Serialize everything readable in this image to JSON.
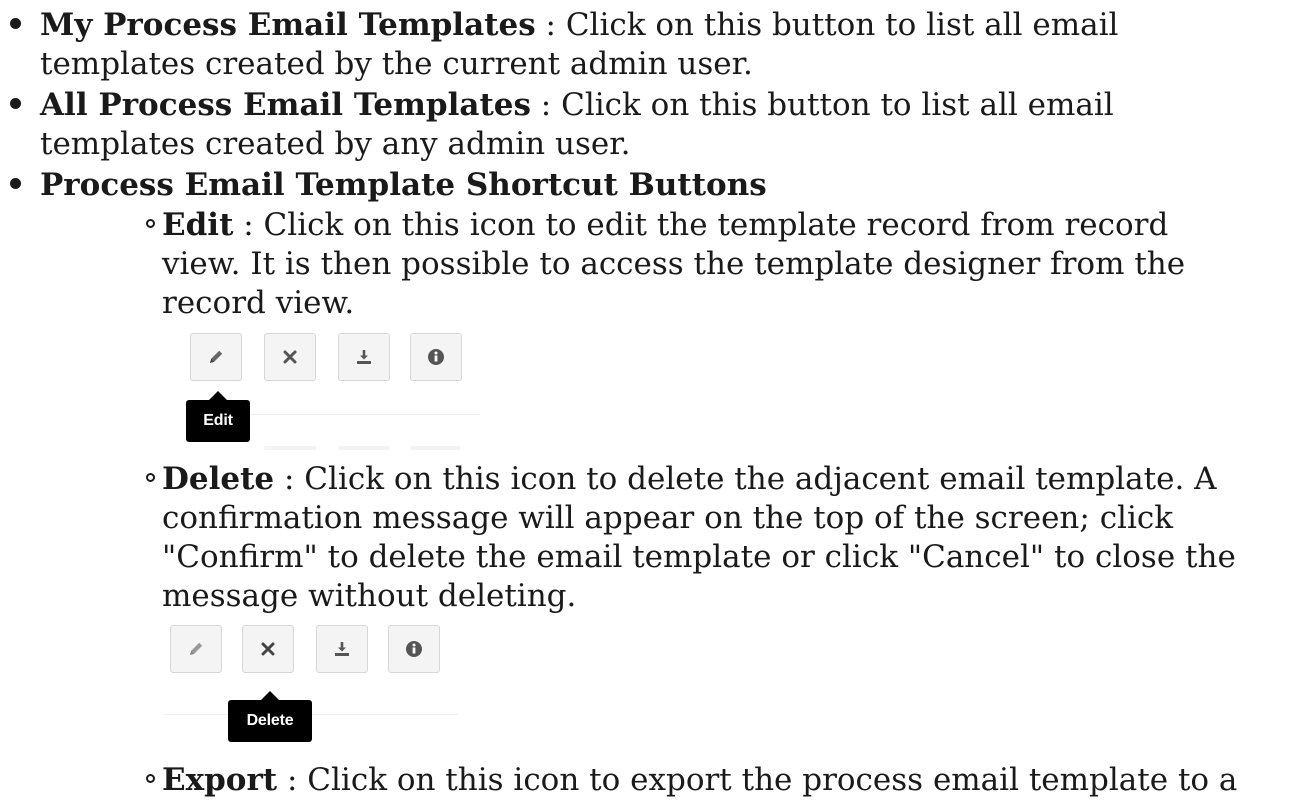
{
  "items": [
    {
      "title": "My Process Email Templates",
      "line1": " : Click on this button to list all email",
      "line2": "templates created by the current admin user."
    },
    {
      "title": "All Process Email Templates",
      "line1": " : Click on this button to list all email",
      "line2": "templates created by any admin user."
    },
    {
      "title": "Process Email Template Shortcut Buttons"
    }
  ],
  "sub_items": [
    {
      "title": "Edit",
      "line1": " : Click on this icon to edit the template record from record",
      "line2": "view. It is then possible to access the template designer from the",
      "line3": "record view.",
      "tooltip": "Edit"
    },
    {
      "title": "Delete",
      "line1": " : Click on this icon to delete the adjacent email template. A",
      "line2": "confirmation message will appear on the top of the screen; click",
      "line3": "\"Confirm\" to delete the email template or click \"Cancel\" to close the",
      "line4": "message without deleting.",
      "tooltip": "Delete"
    },
    {
      "title": "Export",
      "line1": " : Click on this icon to export the process email template to a"
    }
  ],
  "icons": [
    "pencil-icon",
    "close-icon",
    "download-icon",
    "info-icon"
  ]
}
